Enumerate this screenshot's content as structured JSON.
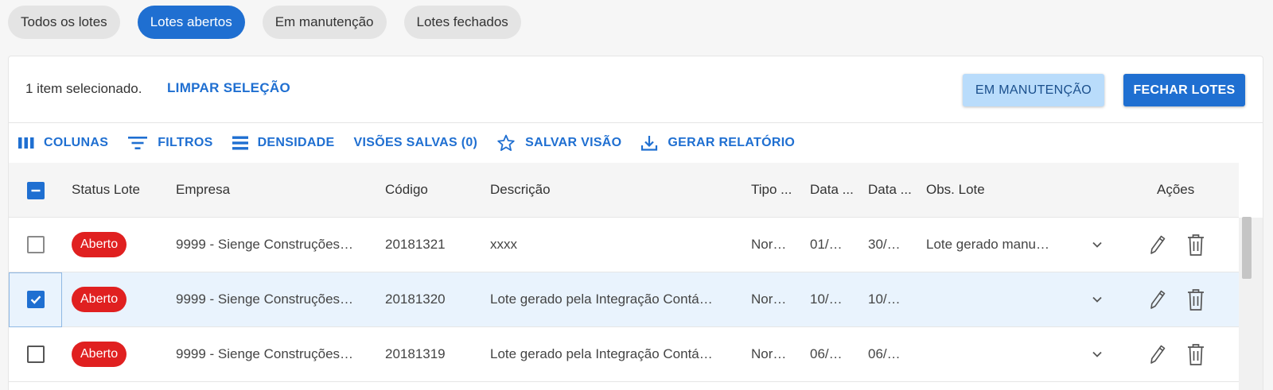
{
  "tabs": [
    {
      "label": "Todos os lotes",
      "active": false
    },
    {
      "label": "Lotes abertos",
      "active": true
    },
    {
      "label": "Em manutenção",
      "active": false
    },
    {
      "label": "Lotes fechados",
      "active": false
    }
  ],
  "selection": {
    "count_text": "1 item selecionado.",
    "clear_label": "LIMPAR SELEÇÃO",
    "maint_button": "EM MANUTENÇÃO",
    "close_button": "FECHAR LOTES"
  },
  "toolbar": {
    "columns": "COLUNAS",
    "filters": "FILTROS",
    "density": "DENSIDADE",
    "saved_views": "VISÕES SALVAS (0)",
    "save_view": "SALVAR VISÃO",
    "report": "GERAR RELATÓRIO"
  },
  "table": {
    "headers": {
      "status": "Status Lote",
      "empresa": "Empresa",
      "codigo": "Código",
      "descricao": "Descrição",
      "tipo": "Tipo ...",
      "data1": "Data ...",
      "data2": "Data ...",
      "obs": "Obs. Lote",
      "acoes": "Ações"
    },
    "rows": [
      {
        "checked": false,
        "status": "Aberto",
        "empresa": "9999 - Sienge Construções…",
        "codigo": "20181321",
        "descricao": "xxxx",
        "tipo": "Nor…",
        "data1": "01/…",
        "data2": "30/…",
        "obs": "Lote gerado manu…"
      },
      {
        "checked": true,
        "status": "Aberto",
        "empresa": "9999 - Sienge Construções…",
        "codigo": "20181320",
        "descricao": "Lote gerado pela Integração Contá…",
        "tipo": "Nor…",
        "data1": "10/…",
        "data2": "10/…",
        "obs": ""
      },
      {
        "checked": false,
        "status": "Aberto",
        "empresa": "9999 - Sienge Construções…",
        "codigo": "20181319",
        "descricao": "Lote gerado pela Integração Contá…",
        "tipo": "Nor…",
        "data1": "06/…",
        "data2": "06/…",
        "obs": ""
      }
    ]
  },
  "colors": {
    "accent": "#1f6fd1",
    "badge": "#e02020",
    "selected_row": "#e9f3fd"
  }
}
